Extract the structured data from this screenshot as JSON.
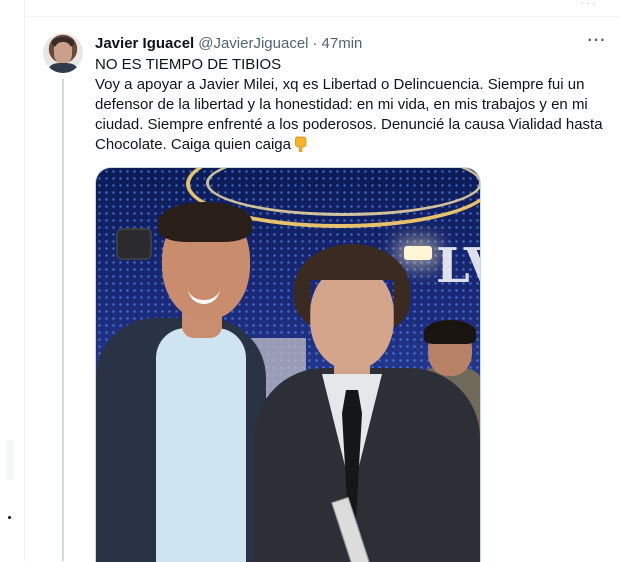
{
  "tweet": {
    "author_name": "Javier Iguacel",
    "handle": "@JavierJiguacel",
    "separator": "·",
    "time": "47min",
    "more_label": "···",
    "text_line1": "NO ES TIEMPO DE TIBIOS",
    "text_body": "Voy a apoyar a Javier Milei, xq es Libertad o Delincuencia. Siempre fui un defensor de la libertad y la honestidad: en mi vida, en mis trabajos y en mi ciudad. Siempre enfrenté a los poderosos. Denuncié la causa Vialidad hasta Chocolate. Caiga quien caiga",
    "emoji": "backhand-index-pointing-down"
  },
  "colors": {
    "text_primary": "#0f1419",
    "text_secondary": "#536471",
    "border": "#cfd9de",
    "emoji": "#f5b52e"
  }
}
